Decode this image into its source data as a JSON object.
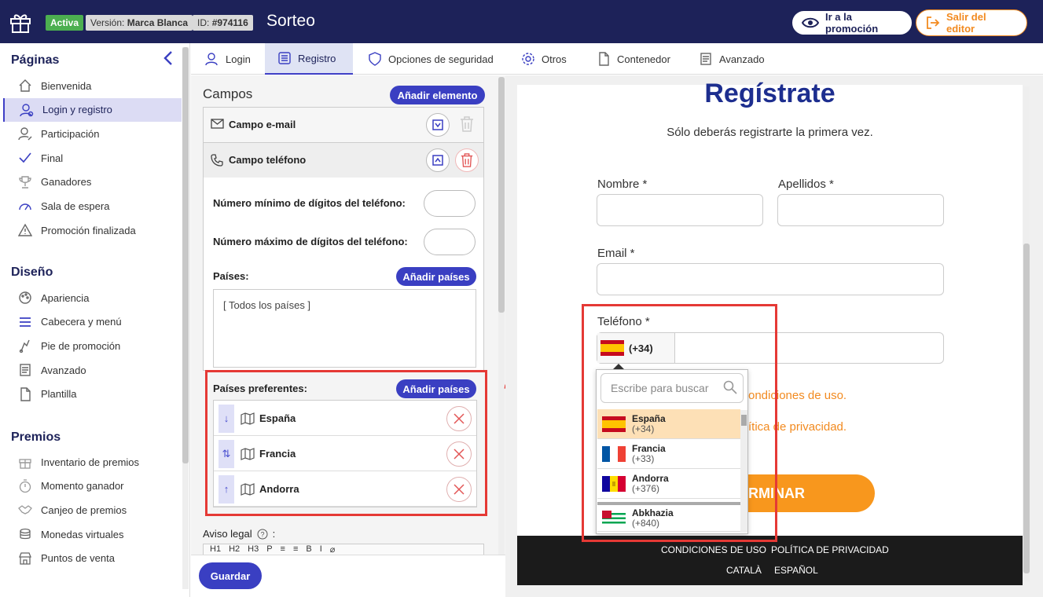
{
  "header": {
    "status_badge": "Activa",
    "version_label": "Versión:",
    "version_value": "Marca Blanca",
    "id_label": "ID:",
    "id_value": "#974116",
    "title": "Sorteo",
    "go_promo": "Ir a la promoción",
    "exit_editor": "Salir del editor"
  },
  "sidebar": {
    "paginas_title": "Páginas",
    "paginas": [
      {
        "label": "Bienvenida",
        "icon": "home-icon"
      },
      {
        "label": "Login y registro",
        "icon": "user-login-icon"
      },
      {
        "label": "Participación",
        "icon": "user-edit-icon"
      },
      {
        "label": "Final",
        "icon": "check-icon"
      },
      {
        "label": "Ganadores",
        "icon": "trophy-icon"
      },
      {
        "label": "Sala de espera",
        "icon": "gauge-icon"
      },
      {
        "label": "Promoción finalizada",
        "icon": "warning-icon"
      }
    ],
    "diseno_title": "Diseño",
    "diseno": [
      {
        "label": "Apariencia",
        "icon": "palette-icon"
      },
      {
        "label": "Cabecera y menú",
        "icon": "menu-icon"
      },
      {
        "label": "Pie de promoción",
        "icon": "footer-icon"
      },
      {
        "label": "Avanzado",
        "icon": "document-icon"
      },
      {
        "label": "Plantilla",
        "icon": "file-icon"
      }
    ],
    "premios_title": "Premios",
    "premios": [
      {
        "label": "Inventario de premios",
        "icon": "gift-icon"
      },
      {
        "label": "Momento ganador",
        "icon": "stopwatch-icon"
      },
      {
        "label": "Canjeo de premios",
        "icon": "handshake-icon"
      },
      {
        "label": "Monedas virtuales",
        "icon": "coins-icon"
      },
      {
        "label": "Puntos de venta",
        "icon": "store-icon"
      }
    ]
  },
  "tabs": [
    {
      "label": "Login",
      "icon": "user-icon"
    },
    {
      "label": "Registro",
      "icon": "form-icon",
      "selected": true
    },
    {
      "label": "Opciones de seguridad",
      "icon": "shield-icon"
    },
    {
      "label": "Otros",
      "icon": "gear-icon"
    },
    {
      "label": "Contenedor",
      "icon": "file-icon"
    },
    {
      "label": "Avanzado",
      "icon": "document-icon"
    }
  ],
  "editor": {
    "campos_title": "Campos",
    "add_element": "Añadir elemento",
    "field_email": "Campo e-mail",
    "field_phone": "Campo teléfono",
    "min_digits": "Número mínimo de dígitos del teléfono:",
    "max_digits": "Número máximo de dígitos del teléfono:",
    "paises_label": "Países:",
    "add_countries": "Añadir países",
    "all_countries": "[ Todos los países ]",
    "preferred_label": "Países preferentes:",
    "preferred": [
      {
        "name": "España",
        "arrow": "↓"
      },
      {
        "name": "Francia",
        "arrow": "⇅"
      },
      {
        "name": "Andorra",
        "arrow": "↑"
      }
    ],
    "aviso_legal": "Aviso legal",
    "aviso_suffix": ":",
    "toolbar": [
      "H1",
      "H2",
      "H3",
      "P",
      "≡",
      "≡",
      "B",
      "I",
      "⌀"
    ],
    "save": "Guardar"
  },
  "preview": {
    "title": "Regístrate",
    "subtitle": "Sólo deberás registrarte la primera vez.",
    "nombre": "Nombre *",
    "apellidos": "Apellidos *",
    "email": "Email *",
    "telefono": "Teléfono *",
    "phone_code": "(+34)",
    "terms_fragment": "ondiciones de uso.",
    "privacy_fragment": "ítica de privacidad.",
    "submit_fragment": "RMINAR",
    "search_placeholder": "Escribe para buscar",
    "countries": [
      {
        "name": "España",
        "code": "(+34)"
      },
      {
        "name": "Francia",
        "code": "(+33)"
      },
      {
        "name": "Andorra",
        "code": "(+376)"
      },
      {
        "name": "Abkhazia",
        "code": "(+840)"
      }
    ],
    "footer": {
      "conditions": "CONDICIONES DE USO",
      "privacy": "POLÍTICA DE PRIVACIDAD",
      "catala": "CATALÀ",
      "espanol": "ESPAÑOL"
    }
  },
  "colors": {
    "navy": "#1d2259",
    "accent": "#3a3fc2",
    "orange": "#f28a1f",
    "red_highlight": "#e53935",
    "green": "#4caf50"
  }
}
